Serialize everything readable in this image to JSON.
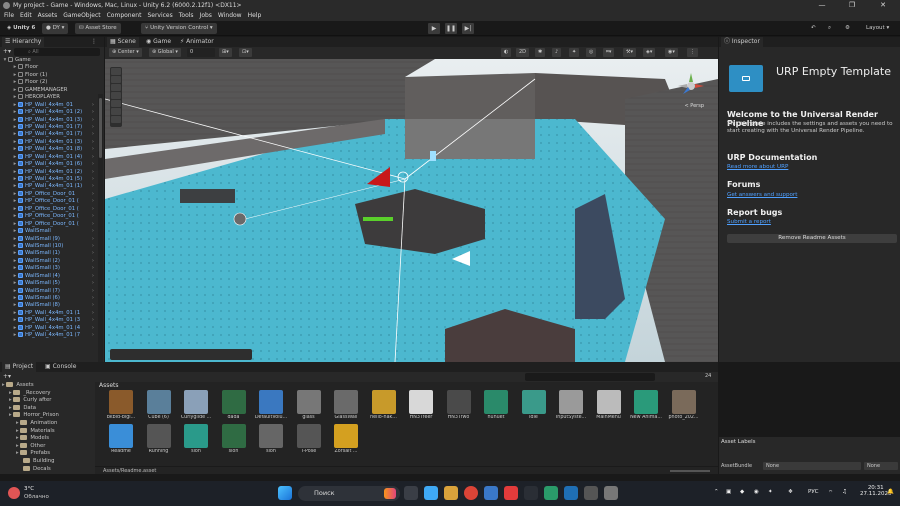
{
  "window": {
    "title": "My project - Game - Windows, Mac, Linux - Unity 6.2 (6000.2.12f1) <DX11>",
    "controls": [
      "—",
      "❐",
      "✕"
    ]
  },
  "menu": [
    "File",
    "Edit",
    "Assets",
    "GameObject",
    "Component",
    "Services",
    "Tools",
    "Jobs",
    "Window",
    "Help"
  ],
  "toolbar": {
    "unity_label": "Unity 6",
    "account": "DY",
    "asset_store": "Asset Store",
    "version_control": "Unity Version Control",
    "layout": "Layout"
  },
  "hierarchy": {
    "tab": "Hierarchy",
    "search_placeholder": "All",
    "items": [
      {
        "label": "Game",
        "level": 0,
        "type": "scene"
      },
      {
        "label": "Floor",
        "level": 1,
        "type": "obj"
      },
      {
        "label": "Floor (1)",
        "level": 1,
        "type": "obj"
      },
      {
        "label": "Floor (2)",
        "level": 1,
        "type": "obj"
      },
      {
        "label": "GAMEMANAGER",
        "level": 1,
        "type": "obj"
      },
      {
        "label": "HEROPLAYER",
        "level": 1,
        "type": "obj"
      },
      {
        "label": "HP_Wall_4x4m_01",
        "level": 1,
        "type": "prefab"
      },
      {
        "label": "HP_Wall_4x4m_01 (2)",
        "level": 1,
        "type": "prefab"
      },
      {
        "label": "HP_Wall_4x4m_01 (3)",
        "level": 1,
        "type": "prefab"
      },
      {
        "label": "HP_Wall_4x4m_01 (7)",
        "level": 1,
        "type": "prefab"
      },
      {
        "label": "HP_Wall_4x4m_01 (7)",
        "level": 1,
        "type": "prefab"
      },
      {
        "label": "HP_Wall_4x4m_01 (3)",
        "level": 1,
        "type": "prefab"
      },
      {
        "label": "HP_Wall_4x4m_01 (8)",
        "level": 1,
        "type": "prefab"
      },
      {
        "label": "HP_Wall_4x4m_01 (4)",
        "level": 1,
        "type": "prefab"
      },
      {
        "label": "HP_Wall_4x4m_01 (6)",
        "level": 1,
        "type": "prefab"
      },
      {
        "label": "HP_Wall_4x4m_01 (2)",
        "level": 1,
        "type": "prefab"
      },
      {
        "label": "HP_Wall_4x4m_01 (5)",
        "level": 1,
        "type": "prefab"
      },
      {
        "label": "HP_Wall_4x4m_01 (1)",
        "level": 1,
        "type": "prefab"
      },
      {
        "label": "HP_Office_Door_01",
        "level": 1,
        "type": "prefab"
      },
      {
        "label": "HP_Office_Door_01 (",
        "level": 1,
        "type": "prefab"
      },
      {
        "label": "HP_Office_Door_01 (",
        "level": 1,
        "type": "prefab"
      },
      {
        "label": "HP_Office_Door_01 (",
        "level": 1,
        "type": "prefab"
      },
      {
        "label": "HP_Office_Door_01 (",
        "level": 1,
        "type": "prefab"
      },
      {
        "label": "WallSmall",
        "level": 1,
        "type": "prefab"
      },
      {
        "label": "WallSmall (9)",
        "level": 1,
        "type": "prefab"
      },
      {
        "label": "WallSmall (10)",
        "level": 1,
        "type": "prefab"
      },
      {
        "label": "WallSmall (1)",
        "level": 1,
        "type": "prefab"
      },
      {
        "label": "WallSmall (2)",
        "level": 1,
        "type": "prefab"
      },
      {
        "label": "WallSmall (3)",
        "level": 1,
        "type": "prefab"
      },
      {
        "label": "WallSmall (4)",
        "level": 1,
        "type": "prefab"
      },
      {
        "label": "WallSmall (5)",
        "level": 1,
        "type": "prefab"
      },
      {
        "label": "WallSmall (7)",
        "level": 1,
        "type": "prefab"
      },
      {
        "label": "WallSmall (6)",
        "level": 1,
        "type": "prefab"
      },
      {
        "label": "WallSmall (8)",
        "level": 1,
        "type": "prefab"
      },
      {
        "label": "HP_Wall_4x4m_01 (1",
        "level": 1,
        "type": "prefab"
      },
      {
        "label": "HP_Wall_4x4m_01 (3",
        "level": 1,
        "type": "prefab"
      },
      {
        "label": "HP_Wall_4x4m_01 (4",
        "level": 1,
        "type": "prefab"
      },
      {
        "label": "HP_Wall_4x4m_01 (7",
        "level": 1,
        "type": "prefab"
      }
    ]
  },
  "scene": {
    "tabs": [
      "Scene",
      "Game",
      "Animator"
    ],
    "pivot": "Center",
    "space": "Global",
    "snap_value": "0",
    "persp_label": "< Persp"
  },
  "inspector": {
    "tab": "Inspector",
    "template_title": "URP Empty Template",
    "welcome_heading": "Welcome to the Universal Render Pipeline",
    "welcome_text": "This template includes the settings and assets you need to start creating with the Universal Render Pipeline.",
    "doc_heading": "URP Documentation",
    "doc_link": "Read more about URP",
    "forums_heading": "Forums",
    "forums_link": "Get answers and support",
    "bugs_heading": "Report bugs",
    "bugs_link": "Submit a report",
    "remove_button": "Remove Readme Assets"
  },
  "project": {
    "tabs": [
      "Project",
      "Console"
    ],
    "tree": [
      {
        "label": "Assets",
        "level": 0
      },
      {
        "label": "_Recovery",
        "level": 1
      },
      {
        "label": "Curly after",
        "level": 1
      },
      {
        "label": "Data",
        "level": 1
      },
      {
        "label": "Horror_Prison",
        "level": 1
      },
      {
        "label": "Animation",
        "level": 2
      },
      {
        "label": "Materials",
        "level": 2
      },
      {
        "label": "Models",
        "level": 2
      },
      {
        "label": "Other",
        "level": 2
      },
      {
        "label": "Prefabs",
        "level": 2
      },
      {
        "label": "Building",
        "level": 3
      },
      {
        "label": "Decals",
        "level": 3
      }
    ],
    "breadcrumb": "Assets",
    "slider_count": "24",
    "footer_path": "Assets/Readme.asset",
    "assets_row1": [
      {
        "label": "bkbld-bigl...",
        "color": "#8a5a2b"
      },
      {
        "label": "Cube (6)",
        "color": "#5a7f9a"
      },
      {
        "label": "Curlyglide ...",
        "color": "#8aa0b8"
      },
      {
        "label": "dada",
        "color": "#2f6b43"
      },
      {
        "label": "DefaultVolu...",
        "color": "#3a78c0"
      },
      {
        "label": "glass",
        "color": "#777777"
      },
      {
        "label": "GlassWall",
        "color": "#6a6a6a"
      },
      {
        "label": "hello-nak...",
        "color": "#c89a2a"
      },
      {
        "label": "HN3Tfeer",
        "color": "#d8d8d8"
      },
      {
        "label": "HN3Tfwo",
        "color": "#4a4a4a"
      },
      {
        "label": "hunuet",
        "color": "#2a8a6a"
      },
      {
        "label": "Idle",
        "color": "#3a9a8a"
      },
      {
        "label": "InputSyste...",
        "color": "#9a9a9a"
      },
      {
        "label": "MainMenu",
        "color": "#bbbbbb"
      },
      {
        "label": "New Anima...",
        "color": "#2a9a7a"
      },
      {
        "label": "photo_202...",
        "color": "#7a6a5a"
      }
    ],
    "assets_row2": [
      {
        "label": "Readme",
        "color": "#3a8ed8"
      },
      {
        "label": "Running",
        "color": "#555555"
      },
      {
        "label": "slon",
        "color": "#2a9a8a"
      },
      {
        "label": "slon",
        "color": "#2f6b43"
      },
      {
        "label": "slon",
        "color": "#666666"
      },
      {
        "label": "T-Pose",
        "color": "#555555"
      },
      {
        "label": "Zorsalt ...",
        "color": "#d4a020"
      }
    ]
  },
  "asset_labels": {
    "title": "Asset Labels",
    "bundle_label": "AssetBundle",
    "bundle_value": "None",
    "variant_value": "None"
  },
  "taskbar": {
    "weather_temp": "3°C",
    "weather_text": "Облачно",
    "search": "Поиск",
    "lang": "РУС",
    "time": "20:31",
    "date": "27.11.2025"
  }
}
